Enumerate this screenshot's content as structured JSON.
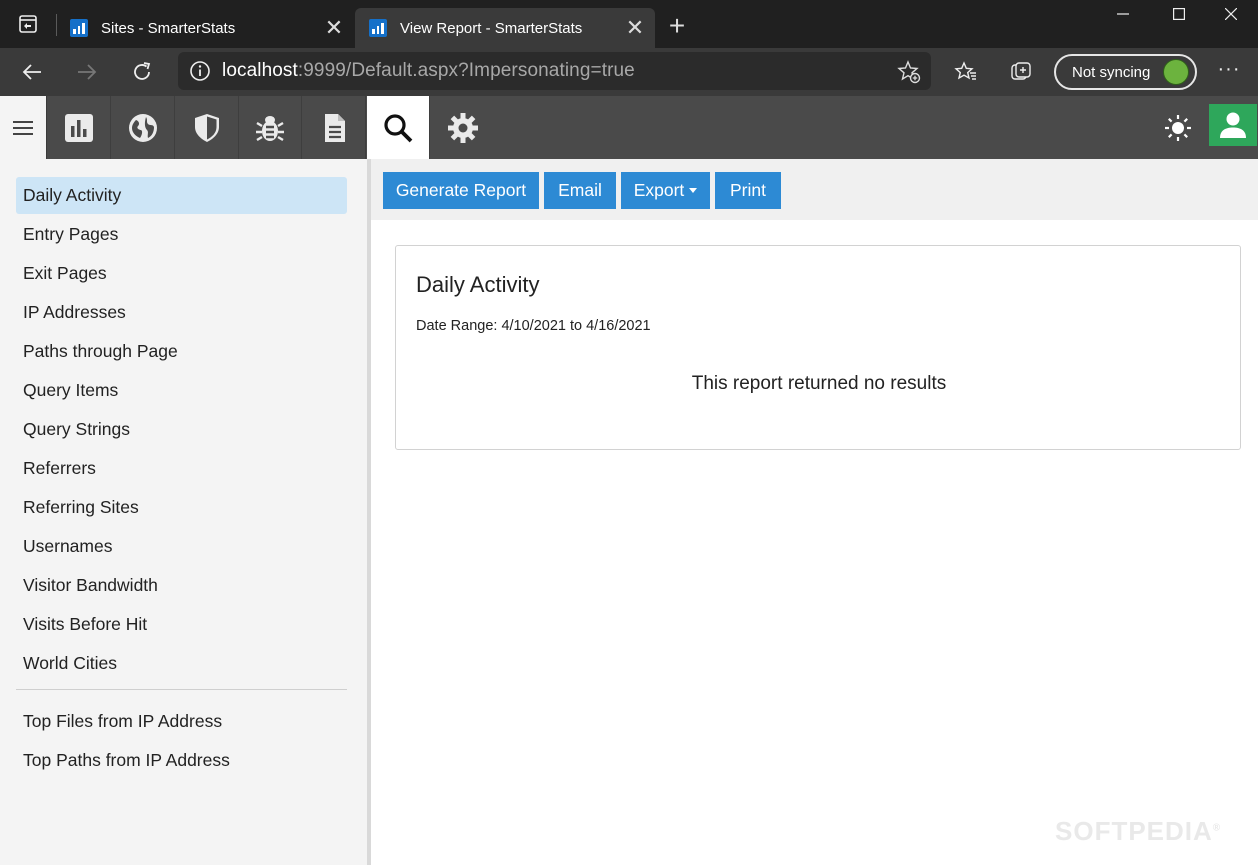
{
  "browser": {
    "tabs": [
      {
        "title": "Sites - SmarterStats",
        "close": "✕",
        "active": false
      },
      {
        "title": "View Report - SmarterStats",
        "close": "✕",
        "active": true
      }
    ],
    "new_tab": "+",
    "window_controls": {
      "minimize": "—",
      "maximize": "☐",
      "close": "✕"
    },
    "address": {
      "host": "localhost",
      "rest": ":9999/Default.aspx?Impersonating=true"
    },
    "sync_label": "Not syncing",
    "more": "···"
  },
  "app": {
    "nav_tabs": [
      {
        "icon": "bar-chart-icon",
        "active": false
      },
      {
        "icon": "globe-icon",
        "active": false
      },
      {
        "icon": "shield-icon",
        "active": false
      },
      {
        "icon": "bug-icon",
        "active": false
      },
      {
        "icon": "document-icon",
        "active": false
      },
      {
        "icon": "search-icon",
        "active": true
      },
      {
        "icon": "gear-icon",
        "active": false
      }
    ]
  },
  "sidebar": {
    "items": [
      "Daily Activity",
      "Entry Pages",
      "Exit Pages",
      "IP Addresses",
      "Paths through Page",
      "Query Items",
      "Query Strings",
      "Referrers",
      "Referring Sites",
      "Usernames",
      "Visitor Bandwidth",
      "Visits Before Hit",
      "World Cities"
    ],
    "active_index": 0,
    "secondary_items": [
      "Top Files from IP Address",
      "Top Paths from IP Address"
    ]
  },
  "actions": {
    "generate": "Generate Report",
    "email": "Email",
    "export": "Export",
    "print": "Print"
  },
  "report": {
    "title": "Daily Activity",
    "date_range": "Date Range: 4/10/2021 to 4/16/2021",
    "empty_message": "This report returned no results"
  },
  "watermark": "SOFTPEDIA",
  "colors": {
    "primary": "#2d8ad4",
    "active_item": "#cde5f6",
    "user_button": "#2ea75b",
    "header": "#4a4a4a"
  }
}
